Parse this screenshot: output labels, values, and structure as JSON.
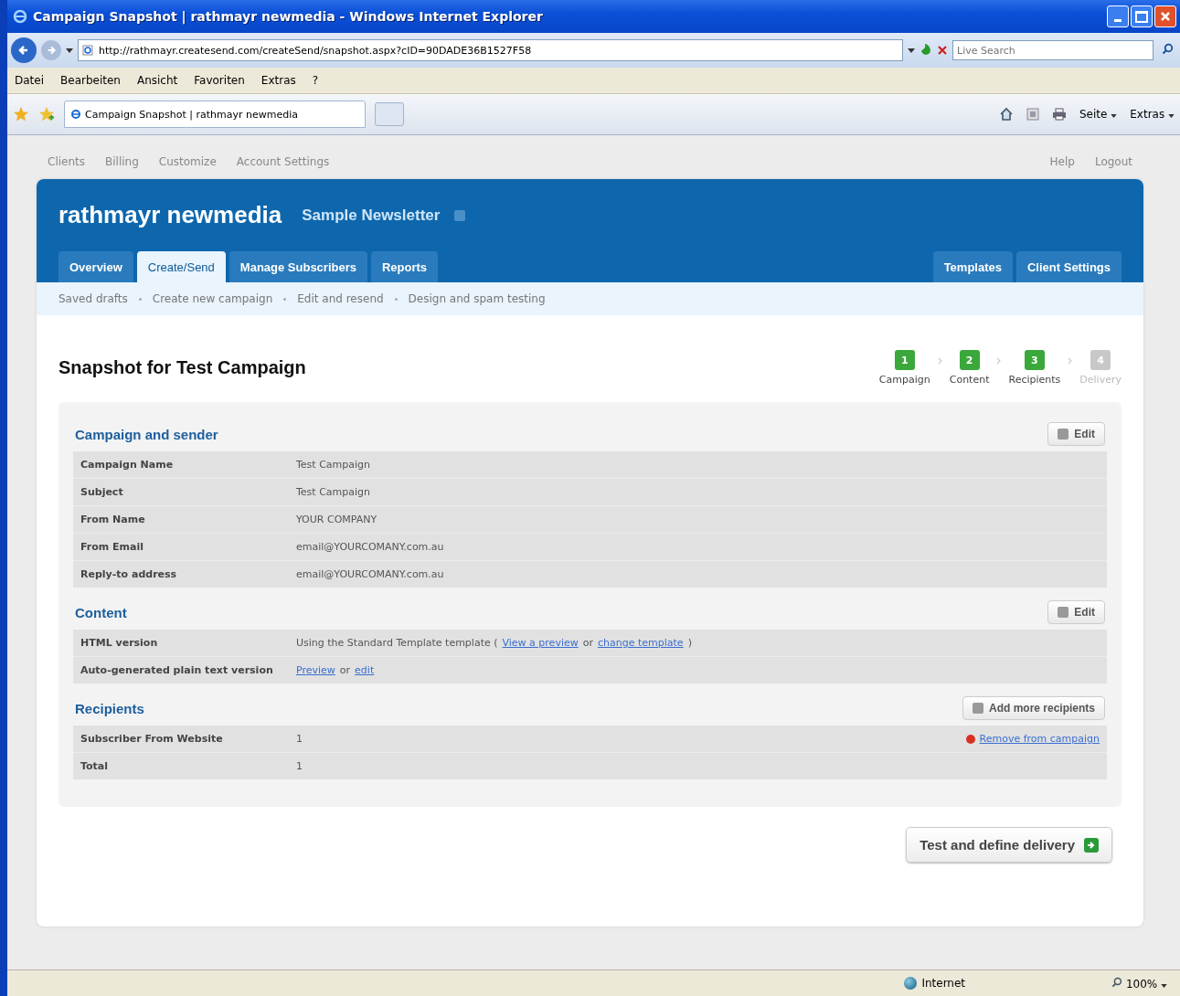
{
  "window": {
    "title": "Campaign Snapshot | rathmayr newmedia - Windows Internet Explorer"
  },
  "address_bar": {
    "url": "http://rathmayr.createsend.com/createSend/snapshot.aspx?cID=90DADE36B1527F58",
    "search_placeholder": "Live Search"
  },
  "menu": [
    "Datei",
    "Bearbeiten",
    "Ansicht",
    "Favoriten",
    "Extras",
    "?"
  ],
  "browser_tab": {
    "title": "Campaign Snapshot | rathmayr newmedia"
  },
  "command_bar": [
    "Seite",
    "Extras"
  ],
  "top_nav": {
    "left": [
      "Clients",
      "Billing",
      "Customize",
      "Account Settings"
    ],
    "right": [
      "Help",
      "Logout"
    ]
  },
  "header": {
    "client": "rathmayr newmedia",
    "list": "Sample Newsletter"
  },
  "tabs": {
    "left": [
      {
        "label": "Overview",
        "selected": false
      },
      {
        "label": "Create/Send",
        "selected": true
      },
      {
        "label": "Manage Subscribers",
        "selected": false
      },
      {
        "label": "Reports",
        "selected": false
      }
    ],
    "right": [
      {
        "label": "Templates",
        "selected": false
      },
      {
        "label": "Client Settings",
        "selected": false
      }
    ]
  },
  "subnav": [
    "Saved drafts",
    "Create new campaign",
    "Edit and resend",
    "Design and spam testing"
  ],
  "page_title": "Snapshot for Test Campaign",
  "steps": [
    {
      "number": "1",
      "label": "Campaign",
      "done": true
    },
    {
      "number": "2",
      "label": "Content",
      "done": true
    },
    {
      "number": "3",
      "label": "Recipients",
      "done": true
    },
    {
      "number": "4",
      "label": "Delivery",
      "done": false
    }
  ],
  "sections": [
    {
      "title": "Campaign and sender",
      "button": "Edit",
      "rows": [
        {
          "label": "Campaign Name",
          "parts": [
            {
              "kind": "text",
              "text": "Test Campaign"
            }
          ]
        },
        {
          "label": "Subject",
          "parts": [
            {
              "kind": "text",
              "text": "Test Campaign"
            }
          ]
        },
        {
          "label": "From Name",
          "parts": [
            {
              "kind": "text",
              "text": "YOUR COMPANY"
            }
          ]
        },
        {
          "label": "From Email",
          "parts": [
            {
              "kind": "text",
              "text": "email@YOURCOMANY.com.au"
            }
          ]
        },
        {
          "label": "Reply-to address",
          "parts": [
            {
              "kind": "text",
              "text": "email@YOURCOMANY.com.au"
            }
          ]
        }
      ]
    },
    {
      "title": "Content",
      "button": "Edit",
      "rows": [
        {
          "label": "HTML version",
          "parts": [
            {
              "kind": "text",
              "text": "Using the Standard Template template ("
            },
            {
              "kind": "link",
              "text": "View a preview"
            },
            {
              "kind": "text",
              "text": "or"
            },
            {
              "kind": "link",
              "text": "change template"
            },
            {
              "kind": "text",
              "text": ")"
            }
          ]
        },
        {
          "label": "Auto-generated plain text version",
          "parts": [
            {
              "kind": "link",
              "text": "Preview"
            },
            {
              "kind": "text",
              "text": "or"
            },
            {
              "kind": "link",
              "text": "edit"
            }
          ]
        }
      ]
    },
    {
      "title": "Recipients",
      "button": "Add more recipients",
      "rows": [
        {
          "label": "Subscriber From Website",
          "parts": [
            {
              "kind": "text",
              "text": "1"
            }
          ],
          "action": "Remove from campaign"
        },
        {
          "label": "Total",
          "parts": [
            {
              "kind": "text",
              "text": "1"
            }
          ]
        }
      ]
    }
  ],
  "primary_button": "Test and define delivery",
  "status_bar": {
    "zone": "Internet",
    "zoom": "100%"
  }
}
